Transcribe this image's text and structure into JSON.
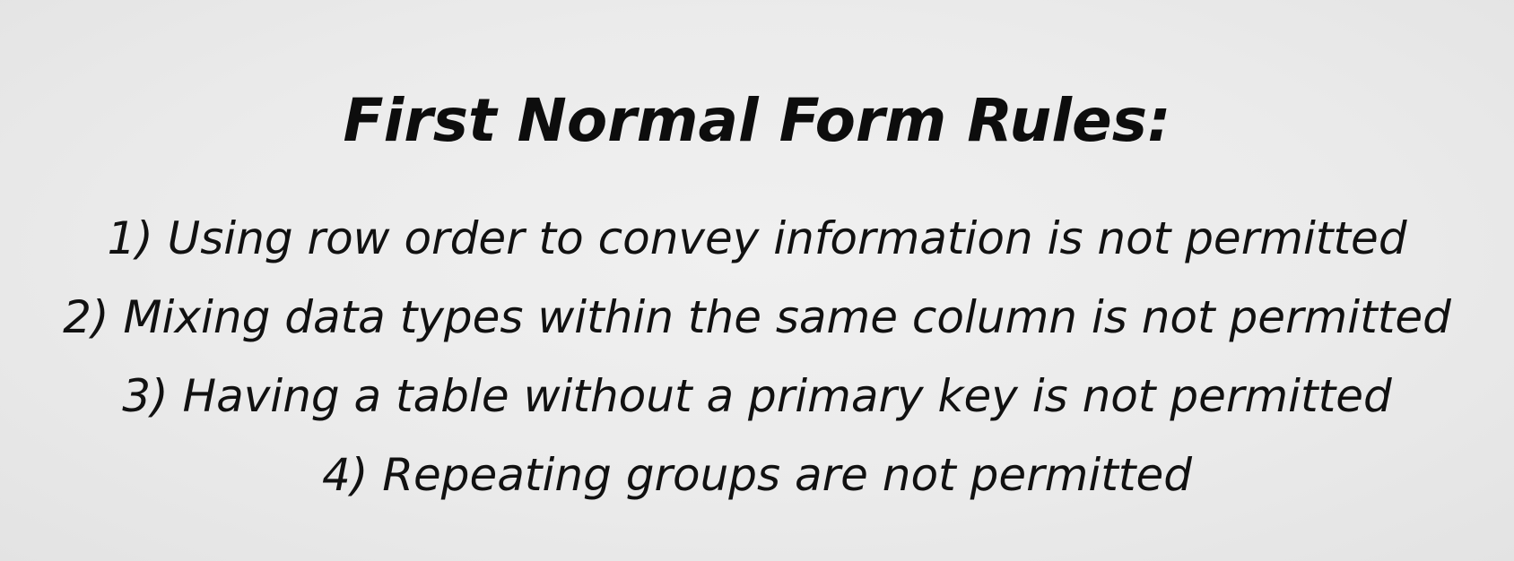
{
  "title": "First Normal Form Rules:",
  "rules": [
    "1) Using row order to convey information is not permitted",
    "2) Mixing data types within the same column is not permitted",
    "3) Having a table without a primary key is not permitted",
    "4) Repeating groups are not permitted"
  ],
  "colors": {
    "background": "#ececec",
    "text": "#111111"
  }
}
